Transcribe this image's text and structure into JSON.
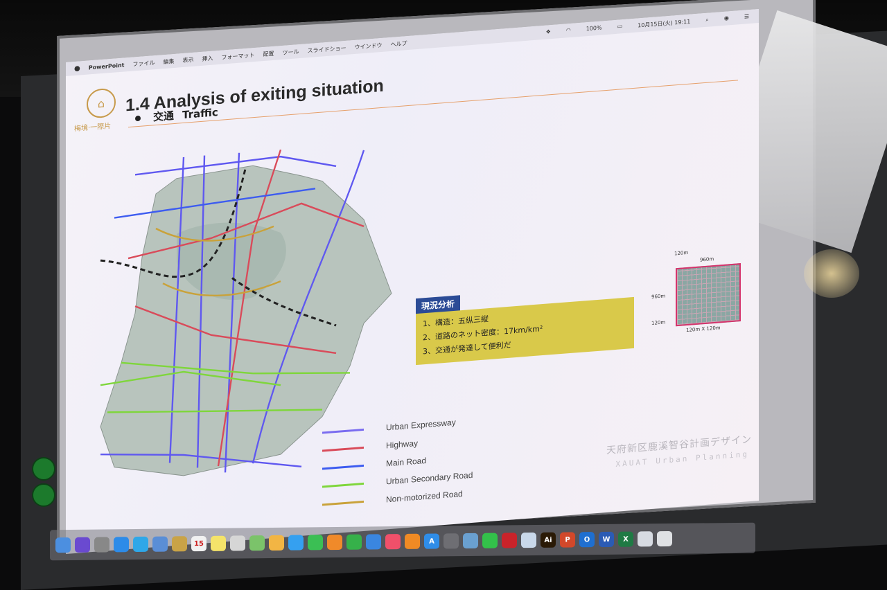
{
  "menubar": {
    "app_name": "PowerPoint",
    "items": [
      "ファイル",
      "編集",
      "表示",
      "挿入",
      "フォーマット",
      "配置",
      "ツール",
      "スライドショー",
      "ウインドウ",
      "ヘルプ"
    ],
    "battery": "100%",
    "date_time": "10月15日(火) 19:11"
  },
  "slide": {
    "title": "1.4 Analysis of exiting situation",
    "subtitle_jp": "交通",
    "subtitle_en": "Traffic",
    "logo_text": "梅境·一際片"
  },
  "analysis": {
    "tag": "現況分析",
    "items": [
      "1、構造：五纵三縦",
      "2、道路のネット密度：17km/km²",
      "3、交通が発達して便利だ"
    ]
  },
  "grid_diagram": {
    "top_small": "120m",
    "top_large": "960m",
    "side_large": "960m",
    "side_small": "120m",
    "bottom": "120m X 120m"
  },
  "legend": [
    {
      "label": "Urban Expressway",
      "color": "#7a6cf0"
    },
    {
      "label": "Highway",
      "color": "#d94b5a"
    },
    {
      "label": "Main Road",
      "color": "#3d5cf0"
    },
    {
      "label": "Urban Secondary Road",
      "color": "#7fd63c"
    },
    {
      "label": "Non-motorized Road",
      "color": "#c9a23a"
    }
  ],
  "footer": {
    "jp": "天府新区鹿溪智谷計画デザイン",
    "en": "XAUAT Urban Planning"
  },
  "dock": [
    {
      "name": "finder-icon",
      "color": "#4c8fe0",
      "glyph": ""
    },
    {
      "name": "siri-icon",
      "color": "#6a4ad0",
      "glyph": ""
    },
    {
      "name": "launchpad-icon",
      "color": "#888",
      "glyph": ""
    },
    {
      "name": "safari-icon",
      "color": "#2d8be8",
      "glyph": ""
    },
    {
      "name": "twitter-icon",
      "color": "#2fa7e8",
      "glyph": ""
    },
    {
      "name": "preview-icon",
      "color": "#5a8ed6",
      "glyph": ""
    },
    {
      "name": "notes-icon",
      "color": "#c9a347",
      "glyph": ""
    },
    {
      "name": "calendar-icon",
      "color": "#f1f1f1",
      "glyph": "15"
    },
    {
      "name": "stickies-icon",
      "color": "#f4e36a",
      "glyph": ""
    },
    {
      "name": "contacts-icon",
      "color": "#d6d6d6",
      "glyph": ""
    },
    {
      "name": "maps-icon",
      "color": "#7bc36a",
      "glyph": ""
    },
    {
      "name": "photos-icon",
      "color": "#f2b544",
      "glyph": ""
    },
    {
      "name": "messages-icon",
      "color": "#35a0f0",
      "glyph": ""
    },
    {
      "name": "facetime-icon",
      "color": "#3bbf54",
      "glyph": ""
    },
    {
      "name": "pages-icon",
      "color": "#f08a2a",
      "glyph": ""
    },
    {
      "name": "numbers-icon",
      "color": "#36b14a",
      "glyph": ""
    },
    {
      "name": "keynote-icon",
      "color": "#3a86e0",
      "glyph": ""
    },
    {
      "name": "music-icon",
      "color": "#f0506a",
      "glyph": ""
    },
    {
      "name": "books-icon",
      "color": "#f08a24",
      "glyph": ""
    },
    {
      "name": "app-store-icon",
      "color": "#2f8de8",
      "glyph": "A"
    },
    {
      "name": "system-preferences-icon",
      "color": "#6e6e73",
      "glyph": ""
    },
    {
      "name": "image-capture-icon",
      "color": "#6aa0d0",
      "glyph": ""
    },
    {
      "name": "line-icon",
      "color": "#33c14a",
      "glyph": ""
    },
    {
      "name": "acrobat-icon",
      "color": "#c9232a",
      "glyph": ""
    },
    {
      "name": "finder-folder-icon",
      "color": "#c9d8ea",
      "glyph": ""
    },
    {
      "name": "illustrator-icon",
      "color": "#2a1a06",
      "glyph": "Ai"
    },
    {
      "name": "powerpoint-icon",
      "color": "#d2482a",
      "glyph": "P"
    },
    {
      "name": "outlook-icon",
      "color": "#1f6fd0",
      "glyph": "O"
    },
    {
      "name": "word-icon",
      "color": "#2b5bb4",
      "glyph": "W"
    },
    {
      "name": "excel-icon",
      "color": "#1f7a44",
      "glyph": "X"
    },
    {
      "name": "desktop-icon",
      "color": "#d7dbe2",
      "glyph": ""
    },
    {
      "name": "trash-icon",
      "color": "#dfe1e4",
      "glyph": ""
    }
  ]
}
